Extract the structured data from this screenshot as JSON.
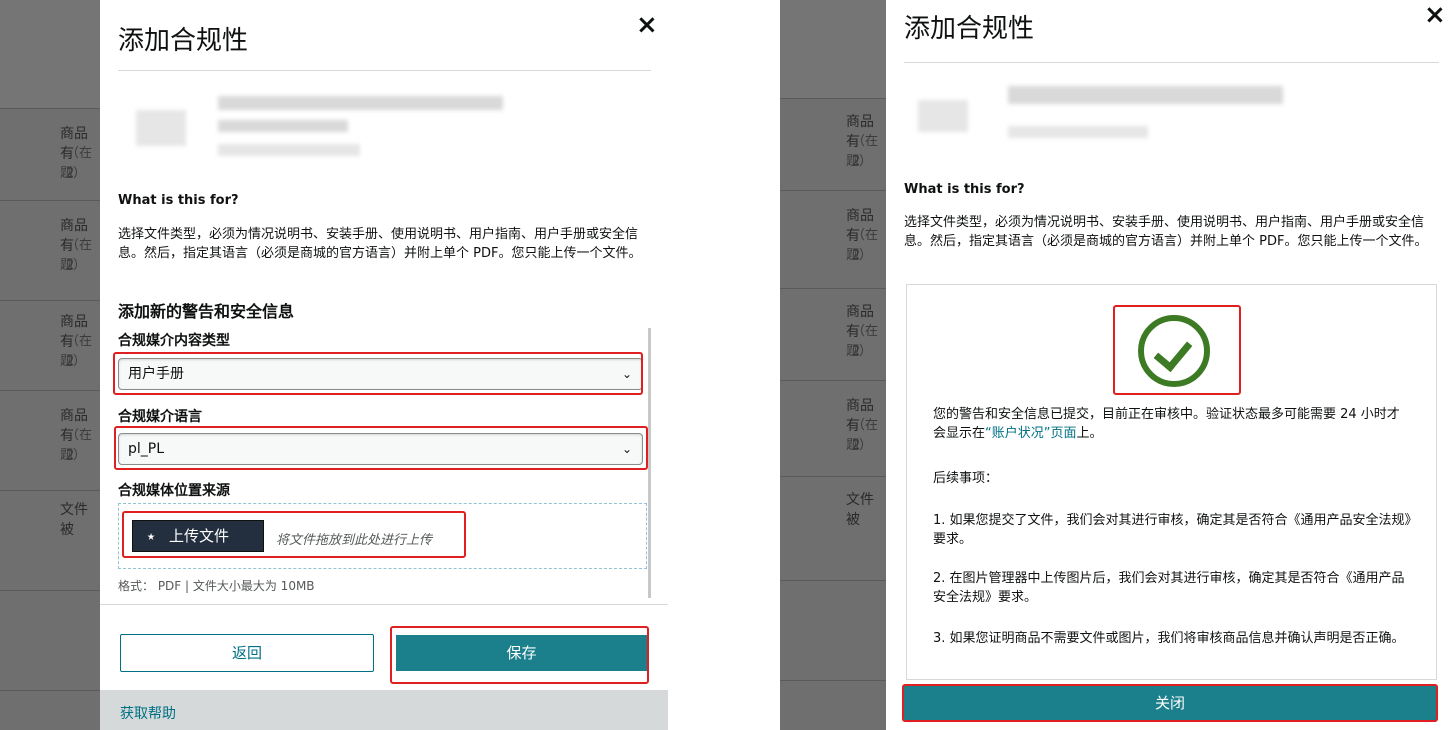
{
  "left": {
    "title": "添加合规性",
    "close_glyph": "×",
    "background_rows": [
      {
        "label": "商品有",
        "sub": "（在 2",
        "tail": "题）"
      },
      {
        "label": "商品有",
        "sub": "（在 2",
        "tail": "题）"
      },
      {
        "label": "商品有",
        "sub": "（在 2",
        "tail": "题）"
      },
      {
        "label": "商品有",
        "sub": "（在 2",
        "tail": "题）"
      },
      {
        "label": "文件被",
        "sub": "",
        "tail": ""
      }
    ],
    "what_heading": "What is this for?",
    "description": "选择文件类型，必须为情况说明书、安装手册、使用说明书、用户指南、用户手册或安全信息。然后，指定其语言（必须是商城的官方语言）并附上单个 PDF。您只能上传一个文件。",
    "section_heading": "添加新的警告和安全信息",
    "content_type_label": "合规媒介内容类型",
    "content_type_value": "用户手册",
    "language_label": "合规媒介语言",
    "language_value": "pl_PL",
    "source_label": "合规媒体位置来源",
    "upload_button": "上传文件",
    "drop_hint": "将文件拖放到此处进行上传",
    "format_note": "格式：  PDF | 文件大小最大为 10MB",
    "back_button": "返回",
    "save_button": "保存",
    "help_link": "获取帮助"
  },
  "right": {
    "title": "添加合规性",
    "close_glyph": "×",
    "background_rows": [
      {
        "label": "商品有",
        "sub": "（在 2",
        "tail": "题）"
      },
      {
        "label": "商品有",
        "sub": "（在 2",
        "tail": "题）"
      },
      {
        "label": "商品有",
        "sub": "（在 2",
        "tail": "题）"
      },
      {
        "label": "商品有",
        "sub": "（在 2",
        "tail": "题）"
      },
      {
        "label": "文件被",
        "sub": "",
        "tail": ""
      }
    ],
    "what_heading": "What is this for?",
    "description": "选择文件类型，必须为情况说明书、安装手册、使用说明书、用户指南、用户手册或安全信息。然后，指定其语言（必须是商城的官方语言）并附上单个 PDF。您只能上传一个文件。",
    "success_msg_pre": "您的警告和安全信息已提交，目前正在审核中。验证状态最多可能需要 24 小时才会显示在",
    "success_msg_link": "“账户状况”页面",
    "success_msg_post": "上。",
    "next_steps": "后续事项：",
    "step1": "1. 如果您提交了文件，我们会对其进行审核，确定其是否符合《通用产品安全法规》要求。",
    "step2": "2. 在图片管理器中上传图片后，我们会对其进行审核，确定其是否符合《通用产品安全法规》要求。",
    "step3": "3. 如果您证明商品不需要文件或图片，我们将审核商品信息并确认声明是否正确。",
    "close_button": "关闭"
  },
  "icons": {
    "upload": "upload-icon",
    "chevron": "chevron-down-icon",
    "success": "check-circle-icon",
    "close": "close-icon"
  },
  "colors": {
    "primary": "#1b7f8c",
    "link": "#007185",
    "highlight": "#e02020",
    "success": "#3d7a24"
  }
}
